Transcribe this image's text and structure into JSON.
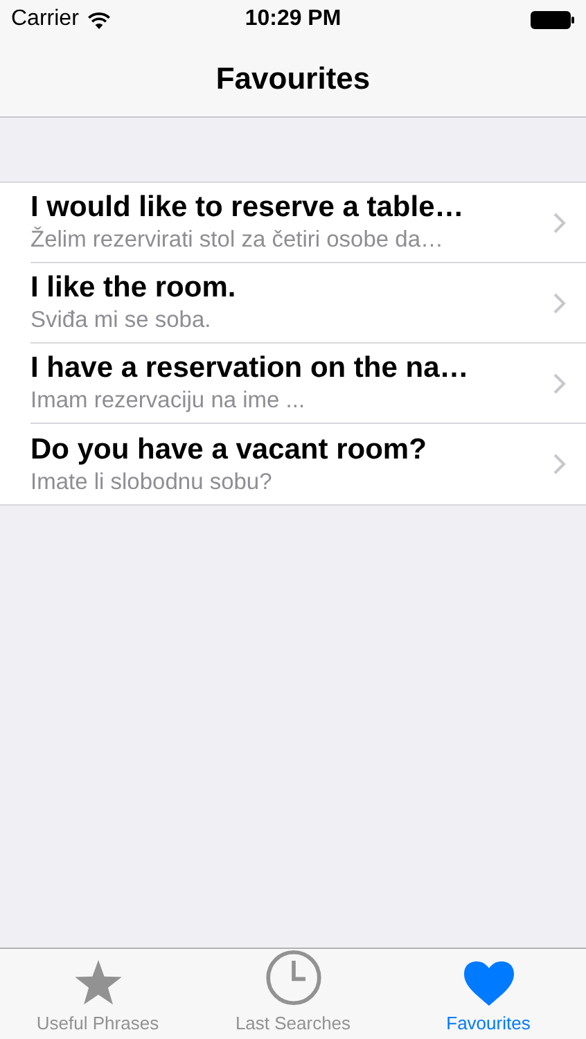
{
  "status_bar": {
    "carrier": "Carrier",
    "time": "10:29 PM"
  },
  "nav_bar": {
    "title": "Favourites"
  },
  "rows": [
    {
      "title": "I would like to reserve a table…",
      "subtitle": "Želim rezervirati stol za četiri osobe da…"
    },
    {
      "title": "I like the room.",
      "subtitle": "Sviđa mi se soba."
    },
    {
      "title": "I have a reservation on the na…",
      "subtitle": "Imam rezervaciju na ime ..."
    },
    {
      "title": "Do you have a vacant room?",
      "subtitle": "Imate li slobodnu sobu?"
    }
  ],
  "tab_bar": [
    {
      "label": "Useful Phrases",
      "kind": "star",
      "selected": false
    },
    {
      "label": "Last Searches",
      "kind": "clock",
      "selected": false
    },
    {
      "label": "Favourites",
      "kind": "heart",
      "selected": true
    }
  ]
}
